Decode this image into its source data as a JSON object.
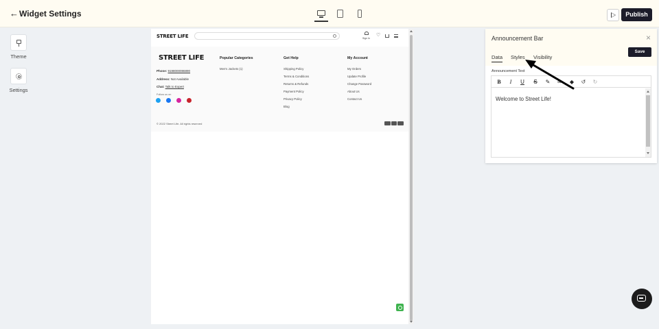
{
  "header": {
    "title": "Widget Settings",
    "publish_label": "Publish",
    "icons": [
      "back-arrow-icon",
      "desktop-icon",
      "tablet-icon",
      "mobile-icon",
      "play-icon"
    ]
  },
  "sidebar": {
    "items": [
      {
        "label": "Theme",
        "icon": "brush-icon"
      },
      {
        "label": "Settings",
        "icon": "gear-icon"
      }
    ]
  },
  "preview": {
    "logo": "STREET LIFE",
    "signin": "Sign In",
    "footer": {
      "logo": "STREET LIFE",
      "phone_label": "Phone:",
      "phone": "9198000086890",
      "address_label": "Address:",
      "address": "Not Available",
      "chat_label": "Chat:",
      "chat_link": "Talk to Expert",
      "follow": "Follow us on",
      "columns": [
        {
          "heading": "Popular Categories",
          "items": [
            "Men's Jackets (1)"
          ]
        },
        {
          "heading": "Get Help",
          "items": [
            "Shipping Policy",
            "Terms & Conditions",
            "Returns & Refunds",
            "Payment Policy",
            "Privacy Policy",
            "Blog"
          ]
        },
        {
          "heading": "My Account",
          "items": [
            "My Orders",
            "Update Profile",
            "Change Password",
            "About Us",
            "Contact Us"
          ]
        }
      ],
      "copyright": "© 2022 Street Life. All rights reserved"
    }
  },
  "panel": {
    "title": "Announcement Bar",
    "save_label": "Save",
    "tabs": [
      {
        "label": "Data",
        "active": true
      },
      {
        "label": "Styles",
        "active": false
      },
      {
        "label": "Visibility",
        "active": false
      }
    ],
    "field_label": "Announcement Text",
    "editor_text": "Welcome to Street Life!",
    "toolbar_icons": [
      "bold-icon",
      "italic-icon",
      "underline-icon",
      "strikethrough-icon",
      "pen-icon",
      "link-icon",
      "eraser-icon",
      "undo-icon",
      "redo-icon"
    ]
  },
  "colors": {
    "topbar_bg": "#fffcf2",
    "dark_button": "#1c1c2a",
    "whatsapp": "#3fb34f"
  }
}
